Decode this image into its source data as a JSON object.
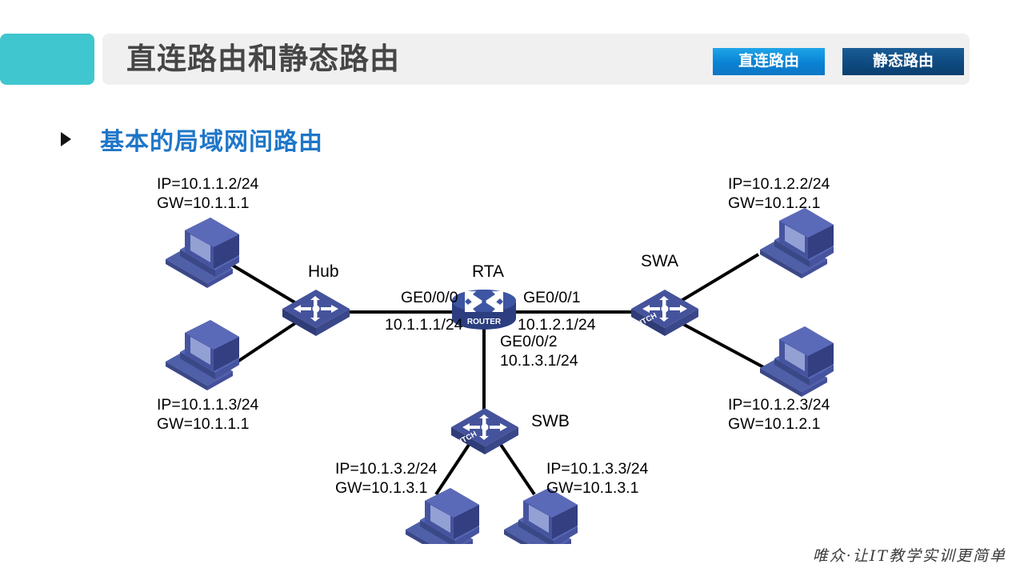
{
  "header": {
    "title": "直连路由和静态路由",
    "accent_color": "#40c6cf",
    "panel_color": "#f0f0f0",
    "tags": [
      {
        "label": "直连路由",
        "color": "#0a82d4"
      },
      {
        "label": "静态路由",
        "color": "#0e4a80"
      }
    ]
  },
  "section": {
    "title": "基本的局域网间路由",
    "title_color": "#1f76c8",
    "bullet": "triangle-right"
  },
  "diagram": {
    "devices": [
      {
        "id": "hub",
        "name": "Hub",
        "type": "hub-icon"
      },
      {
        "id": "rta",
        "name": "RTA",
        "type": "router-icon",
        "icon_text": "ROUTER"
      },
      {
        "id": "swa",
        "name": "SWA",
        "type": "switch-icon",
        "icon_text": "SWITCH"
      },
      {
        "id": "swb",
        "name": "SWB",
        "type": "switch-icon",
        "icon_text": "SWITCH"
      }
    ],
    "hosts": [
      {
        "id": "pc1",
        "ip": "IP=10.1.1.2/24",
        "gw": "GW=10.1.1.1"
      },
      {
        "id": "pc2",
        "ip": "IP=10.1.1.3/24",
        "gw": "GW=10.1.1.1"
      },
      {
        "id": "pc3",
        "ip": "IP=10.1.2.2/24",
        "gw": "GW=10.1.2.1"
      },
      {
        "id": "pc4",
        "ip": "IP=10.1.2.3/24",
        "gw": "GW=10.1.2.1"
      },
      {
        "id": "pc5",
        "ip": "IP=10.1.3.2/24",
        "gw": "GW=10.1.3.1"
      },
      {
        "id": "pc6",
        "ip": "IP=10.1.3.3/24",
        "gw": "GW=10.1.3.1"
      }
    ],
    "interfaces": [
      {
        "id": "ge000",
        "name": "GE0/0/0",
        "address": "10.1.1.1/24"
      },
      {
        "id": "ge001",
        "name": "GE0/0/1",
        "address": "10.1.2.1/24"
      },
      {
        "id": "ge002",
        "name": "GE0/0/2",
        "address": "10.1.3.1/24"
      }
    ]
  },
  "footer": {
    "watermark": "唯众·让IT教学实训更简单"
  }
}
